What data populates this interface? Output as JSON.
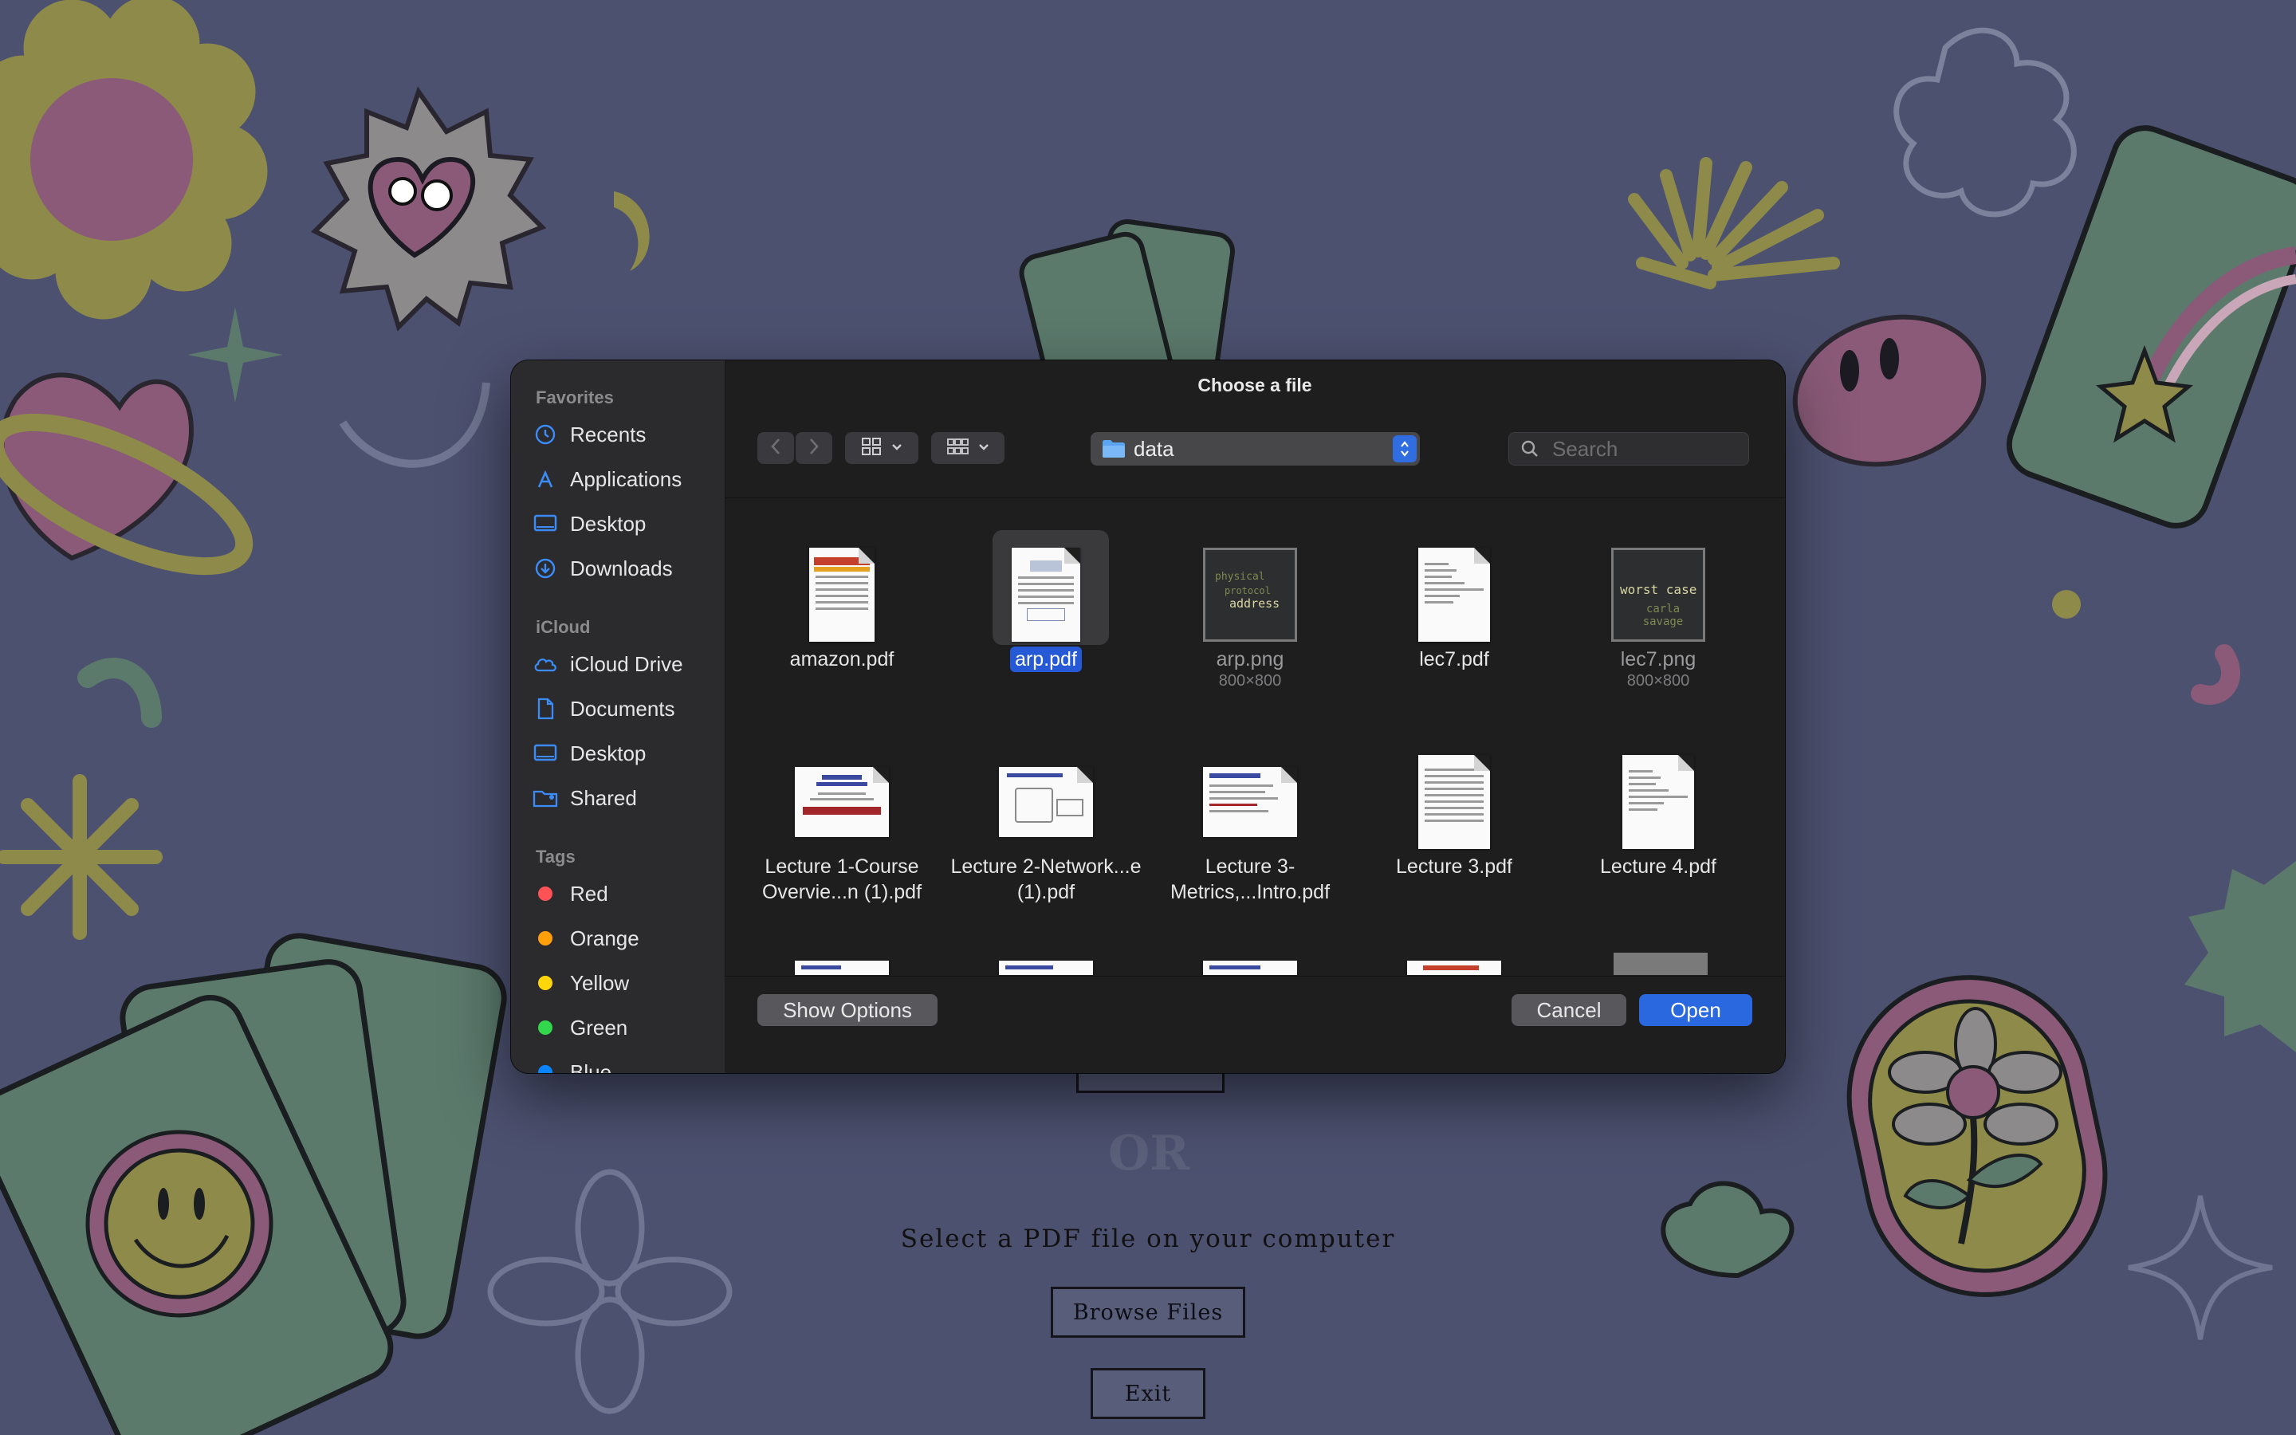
{
  "app": {
    "or_text": "OR",
    "subtitle": "Select a PDF file on your computer",
    "browse_label": "Browse Files",
    "exit_label": "Exit"
  },
  "dialog": {
    "title": "Choose a file",
    "sidebar": {
      "sections": [
        {
          "title": "Favorites",
          "items": [
            {
              "label": "Recents",
              "icon": "clock-icon"
            },
            {
              "label": "Applications",
              "icon": "applications-icon"
            },
            {
              "label": "Desktop",
              "icon": "desktop-icon"
            },
            {
              "label": "Downloads",
              "icon": "downloads-icon"
            }
          ]
        },
        {
          "title": "iCloud",
          "items": [
            {
              "label": "iCloud Drive",
              "icon": "cloud-icon"
            },
            {
              "label": "Documents",
              "icon": "document-icon"
            },
            {
              "label": "Desktop",
              "icon": "desktop-icon"
            },
            {
              "label": "Shared",
              "icon": "shared-folder-icon"
            }
          ]
        },
        {
          "title": "Tags",
          "items": [
            {
              "label": "Red",
              "color": "#ff5257"
            },
            {
              "label": "Orange",
              "color": "#ff9f0a"
            },
            {
              "label": "Yellow",
              "color": "#ffd60a"
            },
            {
              "label": "Green",
              "color": "#32d74b"
            },
            {
              "label": "Blue",
              "color": "#0a84ff"
            }
          ]
        }
      ]
    },
    "toolbar": {
      "back_icon": "chevron-left-icon",
      "forward_icon": "chevron-right-icon",
      "view_icon": "icon-view-icon",
      "group_icon": "group-view-icon"
    },
    "location": "data",
    "search": {
      "placeholder": "Search",
      "value": ""
    },
    "files": [
      {
        "name": "amazon.pdf",
        "dims": "",
        "kind": "pdf-portrait",
        "selected": false
      },
      {
        "name": "arp.pdf",
        "dims": "",
        "kind": "pdf-portrait",
        "selected": true
      },
      {
        "name": "arp.png",
        "dims": "800×800",
        "kind": "image",
        "selected": false
      },
      {
        "name": "lec7.pdf",
        "dims": "",
        "kind": "pdf-portrait",
        "selected": false
      },
      {
        "name": "lec7.png",
        "dims": "800×800",
        "kind": "image",
        "selected": false
      },
      {
        "name": "Lecture 1-Course Overvie...n (1).pdf",
        "dims": "",
        "kind": "pdf-landscape",
        "selected": false
      },
      {
        "name": "Lecture 2-Network...e (1).pdf",
        "dims": "",
        "kind": "pdf-landscape",
        "selected": false
      },
      {
        "name": "Lecture 3-Metrics,...Intro.pdf",
        "dims": "",
        "kind": "pdf-landscape",
        "selected": false
      },
      {
        "name": "Lecture 3.pdf",
        "dims": "",
        "kind": "pdf-portrait",
        "selected": false
      },
      {
        "name": "Lecture 4.pdf",
        "dims": "",
        "kind": "pdf-portrait",
        "selected": false
      }
    ],
    "thumb_text": {
      "arp_png": [
        "physical",
        "protocol",
        "address"
      ],
      "lec7_png": [
        "worst case",
        "carla savage"
      ]
    },
    "buttons": {
      "show_options": "Show Options",
      "cancel": "Cancel",
      "open": "Open"
    },
    "accent_color": "#2a68e0"
  }
}
